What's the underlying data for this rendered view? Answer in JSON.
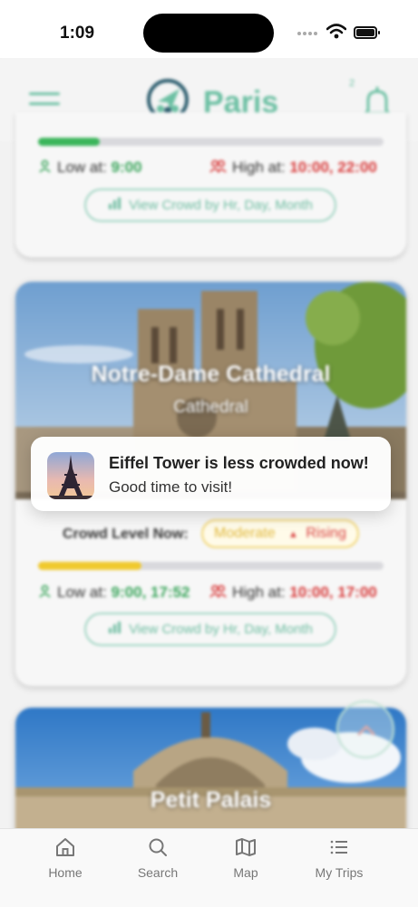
{
  "status_bar": {
    "time": "1:09"
  },
  "header": {
    "city": "Paris",
    "notification_count": "2"
  },
  "cards": [
    {
      "low_label": "Low at:",
      "low_times": "9:00",
      "high_label": "High at:",
      "high_times": "10:00, 22:00",
      "view_button_label": "View Crowd by Hr, Day, Month",
      "colors": {
        "bar": "#3bb55b"
      }
    },
    {
      "title": "Notre-Dame Cathedral",
      "subtitle": "Cathedral",
      "crowd_label": "Crowd Level Now:",
      "crowd_level": "Moderate",
      "crowd_trend": "Rising",
      "crowd_fraction": 0.3,
      "low_label": "Low at:",
      "low_times": "9:00, 17:52",
      "high_label": "High at:",
      "high_times": "10:00, 17:00",
      "view_button_label": "View Crowd by Hr, Day, Month",
      "colors": {
        "bar": "#f0c92e"
      }
    },
    {
      "title": "Petit Palais"
    }
  ],
  "notification": {
    "title": "Eiffel Tower is less crowded now!",
    "body": "Good time to visit!",
    "icon": "eiffel-tower-thumbnail"
  },
  "tabbar": {
    "items": [
      {
        "label": "Home",
        "icon": "home-icon"
      },
      {
        "label": "Search",
        "icon": "search-icon"
      },
      {
        "label": "Map",
        "icon": "map-icon"
      },
      {
        "label": "My Trips",
        "icon": "list-icon"
      }
    ]
  },
  "colors": {
    "accent": "#6cc0a3",
    "low": "#3aa55b",
    "high": "#d83a3a"
  }
}
